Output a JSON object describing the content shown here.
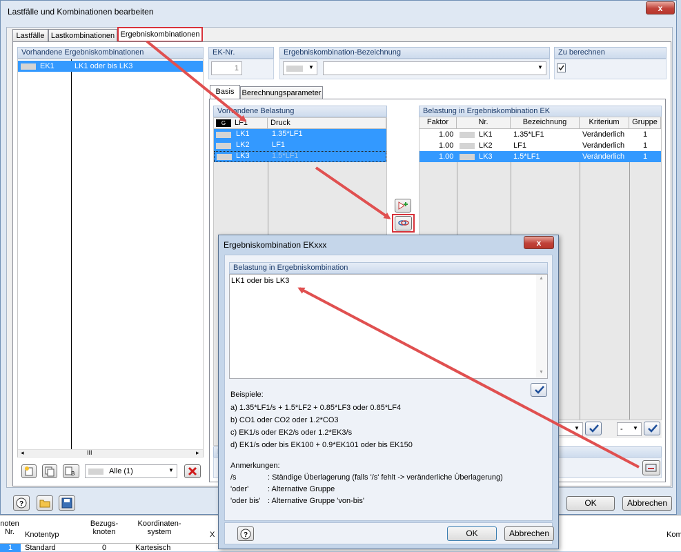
{
  "window": {
    "title": "Lastfälle und Kombinationen bearbeiten",
    "close_glyph": "x"
  },
  "tabs": [
    "Lastfälle",
    "Lastkombinationen",
    "Ergebniskombinationen"
  ],
  "left_panel": {
    "header": "Vorhandene Ergebniskombinationen",
    "rows": [
      {
        "id": "EK1",
        "desc": "LK1 oder bis LK3"
      }
    ],
    "filter_value": "Alle (1)",
    "scroll_grip": "III"
  },
  "ek_nr": {
    "label": "EK-Nr.",
    "value": "1"
  },
  "bezeichnung": {
    "label": "Ergebniskombination-Bezeichnung",
    "value": ""
  },
  "zu_berechnen": {
    "label": "Zu berechnen",
    "checked": true
  },
  "subtabs": [
    "Basis",
    "Berechnungsparameter"
  ],
  "vorhandene": {
    "header": "Vorhandene Belastung",
    "col1": "LF1",
    "col1_badge": "G",
    "col2": "Druck",
    "rows": [
      {
        "id": "LK1",
        "desc": "1.35*LF1"
      },
      {
        "id": "LK2",
        "desc": "LF1"
      },
      {
        "id": "LK3",
        "desc": "1.5*LF1"
      }
    ]
  },
  "belastung_ek": {
    "header": "Belastung in Ergebniskombination EK",
    "columns": [
      "Faktor",
      "Nr.",
      "Bezeichnung",
      "Kriterium",
      "Gruppe"
    ],
    "rows": [
      {
        "faktor": "1.00",
        "nr": "LK1",
        "bez": "1.35*LF1",
        "krit": "Veränderlich",
        "gruppe": "1"
      },
      {
        "faktor": "1.00",
        "nr": "LK2",
        "bez": "LF1",
        "krit": "Veränderlich",
        "gruppe": "1"
      },
      {
        "faktor": "1.00",
        "nr": "LK3",
        "bez": "1.5*LF1",
        "krit": "Veränderlich",
        "gruppe": "1"
      }
    ],
    "group_select": "-"
  },
  "buttons": {
    "ok": "OK",
    "cancel": "Abbrechen"
  },
  "footer_section_letter": "K",
  "bottom_table": {
    "headers": [
      "noten Nr.",
      "Knotentyp",
      "Bezugs-knoten",
      "Koordinaten-system",
      "X",
      "Kom"
    ],
    "row": [
      "1",
      "Standard",
      "0",
      "Kartesisch"
    ]
  },
  "dialog": {
    "title": "Ergebniskombination EKxxx",
    "close_glyph": "x",
    "box_label": "Belastung in Ergebniskombination",
    "formula": "LK1 oder bis LK3",
    "examples_title": "Beispiele:",
    "examples": [
      "a)  1.35*LF1/s + 1.5*LF2 + 0.85*LF3 oder 0.85*LF4",
      "b)  CO1 oder CO2 oder 1.2*CO3",
      "c)  EK1/s oder EK2/s oder 1.2*EK3/s",
      "d)  EK1/s oder bis EK100 + 0.9*EK101 oder bis EK150"
    ],
    "notes_title": "Anmerkungen:",
    "notes": [
      {
        "key": "/s",
        "text": ": Ständige Überlagerung (falls '/s' fehlt -> veränderliche Überlagerung)"
      },
      {
        "key": "'oder'",
        "text": ": Alternative Gruppe"
      },
      {
        "key": "'oder bis'",
        "text": ": Alternative Gruppe 'von-bis'"
      }
    ],
    "ok": "OK",
    "cancel": "Abbrechen"
  },
  "colors": {
    "selection": "#3399ff",
    "highlight_box": "#d8323a",
    "arrow": "#e05050"
  }
}
